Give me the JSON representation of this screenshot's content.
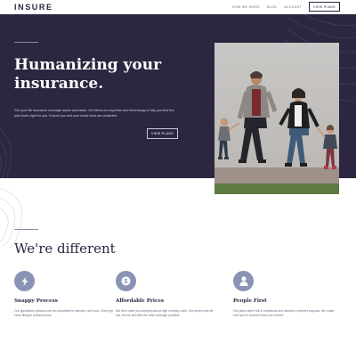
{
  "header": {
    "logo": "INSURE",
    "nav": [
      "HOW WE WORK",
      "BLOG",
      "ACCOUNT"
    ],
    "cta": "VIEW PLANS"
  },
  "hero": {
    "title_line1": "Humanizing your",
    "title_line2": "insurance.",
    "text": "Get your life insurance coverage easier and faster. We blend our expertise and technology to help you find the plan that's right for you. Ensure you and your loved ones are protected.",
    "button": "VIEW PLANS",
    "photo_alt": "family-walking-photo"
  },
  "different": {
    "title": "We're different",
    "features": [
      {
        "icon": "lightning-icon",
        "title": "Snappy Process",
        "text": "Our application process can be completed in minutes, not hours. Don't get stuck filling in tedious forms."
      },
      {
        "icon": "dollar-coin-icon",
        "title": "Affordable Prices",
        "text": "We don't want you worrying about high monthly costs. Our prices may be low, but we still offer the best coverage possible."
      },
      {
        "icon": "person-icon",
        "title": "People First",
        "text": "Our plans aren't full of conditions and clauses to prevent payouts. We make sure you're covered when you need it."
      }
    ]
  },
  "colors": {
    "hero_bg": "#2c2641",
    "icon_circle": "#8a93b4",
    "text_dark": "#2c2641"
  }
}
